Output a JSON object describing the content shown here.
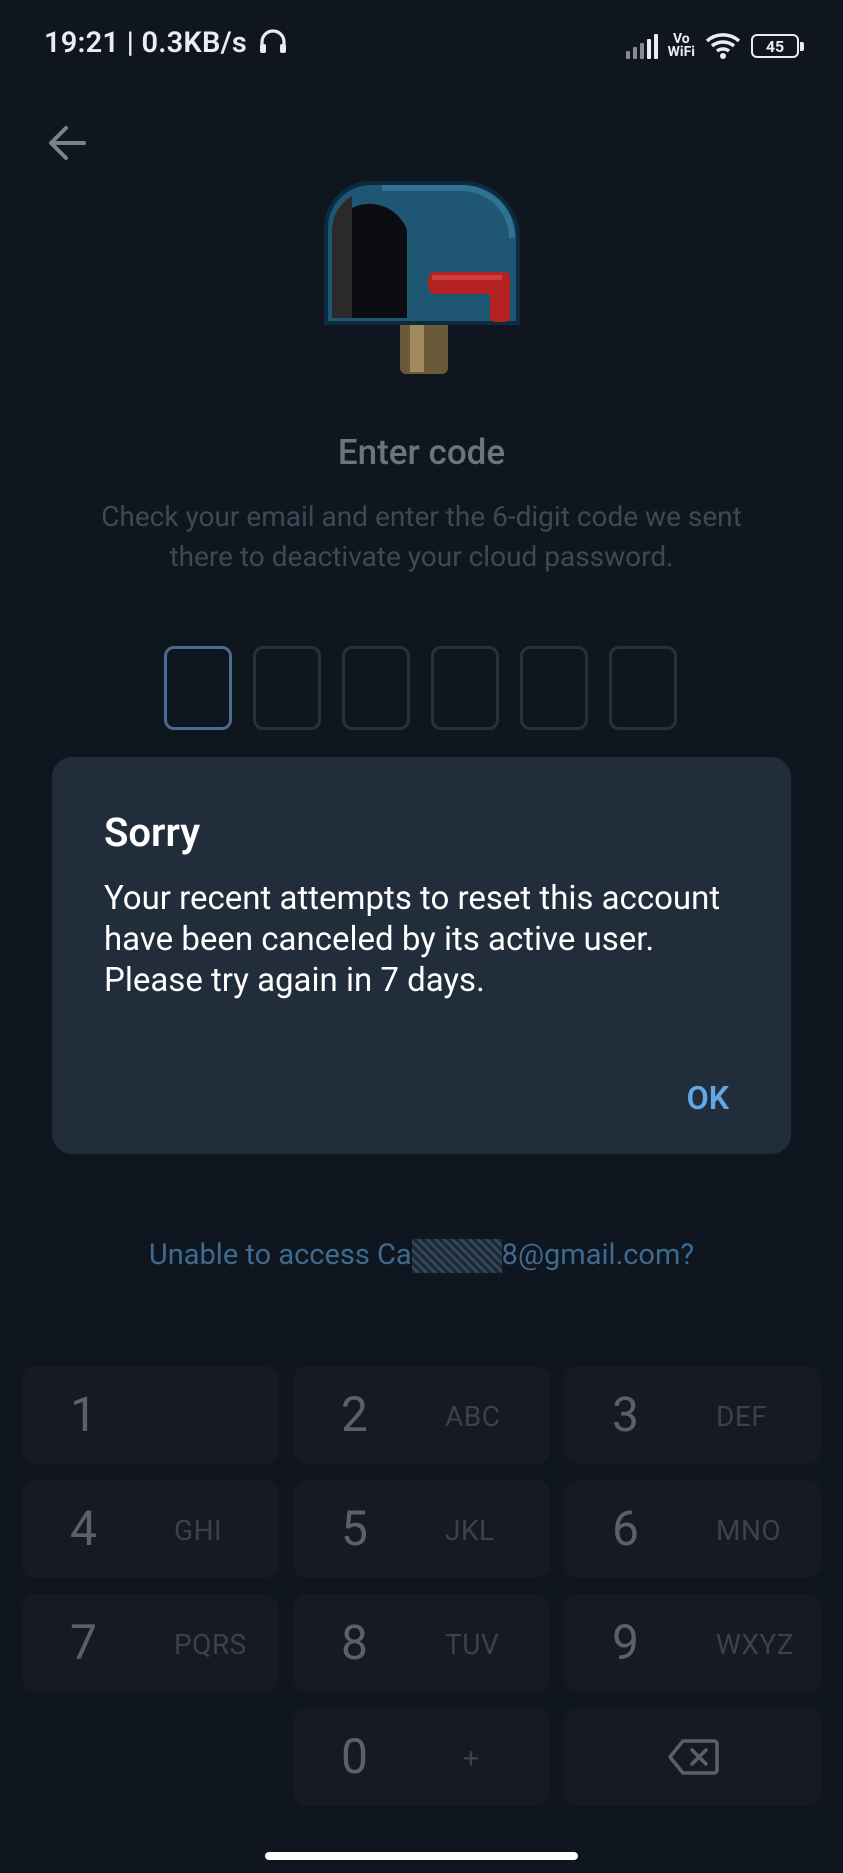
{
  "status_bar": {
    "time": "19:21 | 0.3KB/s",
    "vowifi_top": "Vo",
    "vowifi_bottom": "WiFi",
    "battery": "45"
  },
  "header": {
    "title": "Enter code",
    "subtitle": "Check your email and enter the 6-digit code we sent there to deactivate your cloud password."
  },
  "code_input": {
    "length": 6,
    "active_index": 0
  },
  "dialog": {
    "title": "Sorry",
    "message": "Your recent attempts to reset this account have been canceled by its active user. Please try again in 7 days.",
    "ok_label": "OK"
  },
  "unable_link": {
    "prefix": "Unable to access Ca",
    "suffix": "8@gmail.com?"
  },
  "keypad": {
    "keys": [
      {
        "num": "1",
        "letters": ""
      },
      {
        "num": "2",
        "letters": "ABC"
      },
      {
        "num": "3",
        "letters": "DEF"
      },
      {
        "num": "4",
        "letters": "GHI"
      },
      {
        "num": "5",
        "letters": "JKL"
      },
      {
        "num": "6",
        "letters": "MNO"
      },
      {
        "num": "7",
        "letters": "PQRS"
      },
      {
        "num": "8",
        "letters": "TUV"
      },
      {
        "num": "9",
        "letters": "WXYZ"
      },
      {
        "num": "0",
        "letters": "+"
      }
    ]
  },
  "colors": {
    "background": "#0f1620",
    "dialog": "#222d3b",
    "accent": "#62a8e5"
  }
}
